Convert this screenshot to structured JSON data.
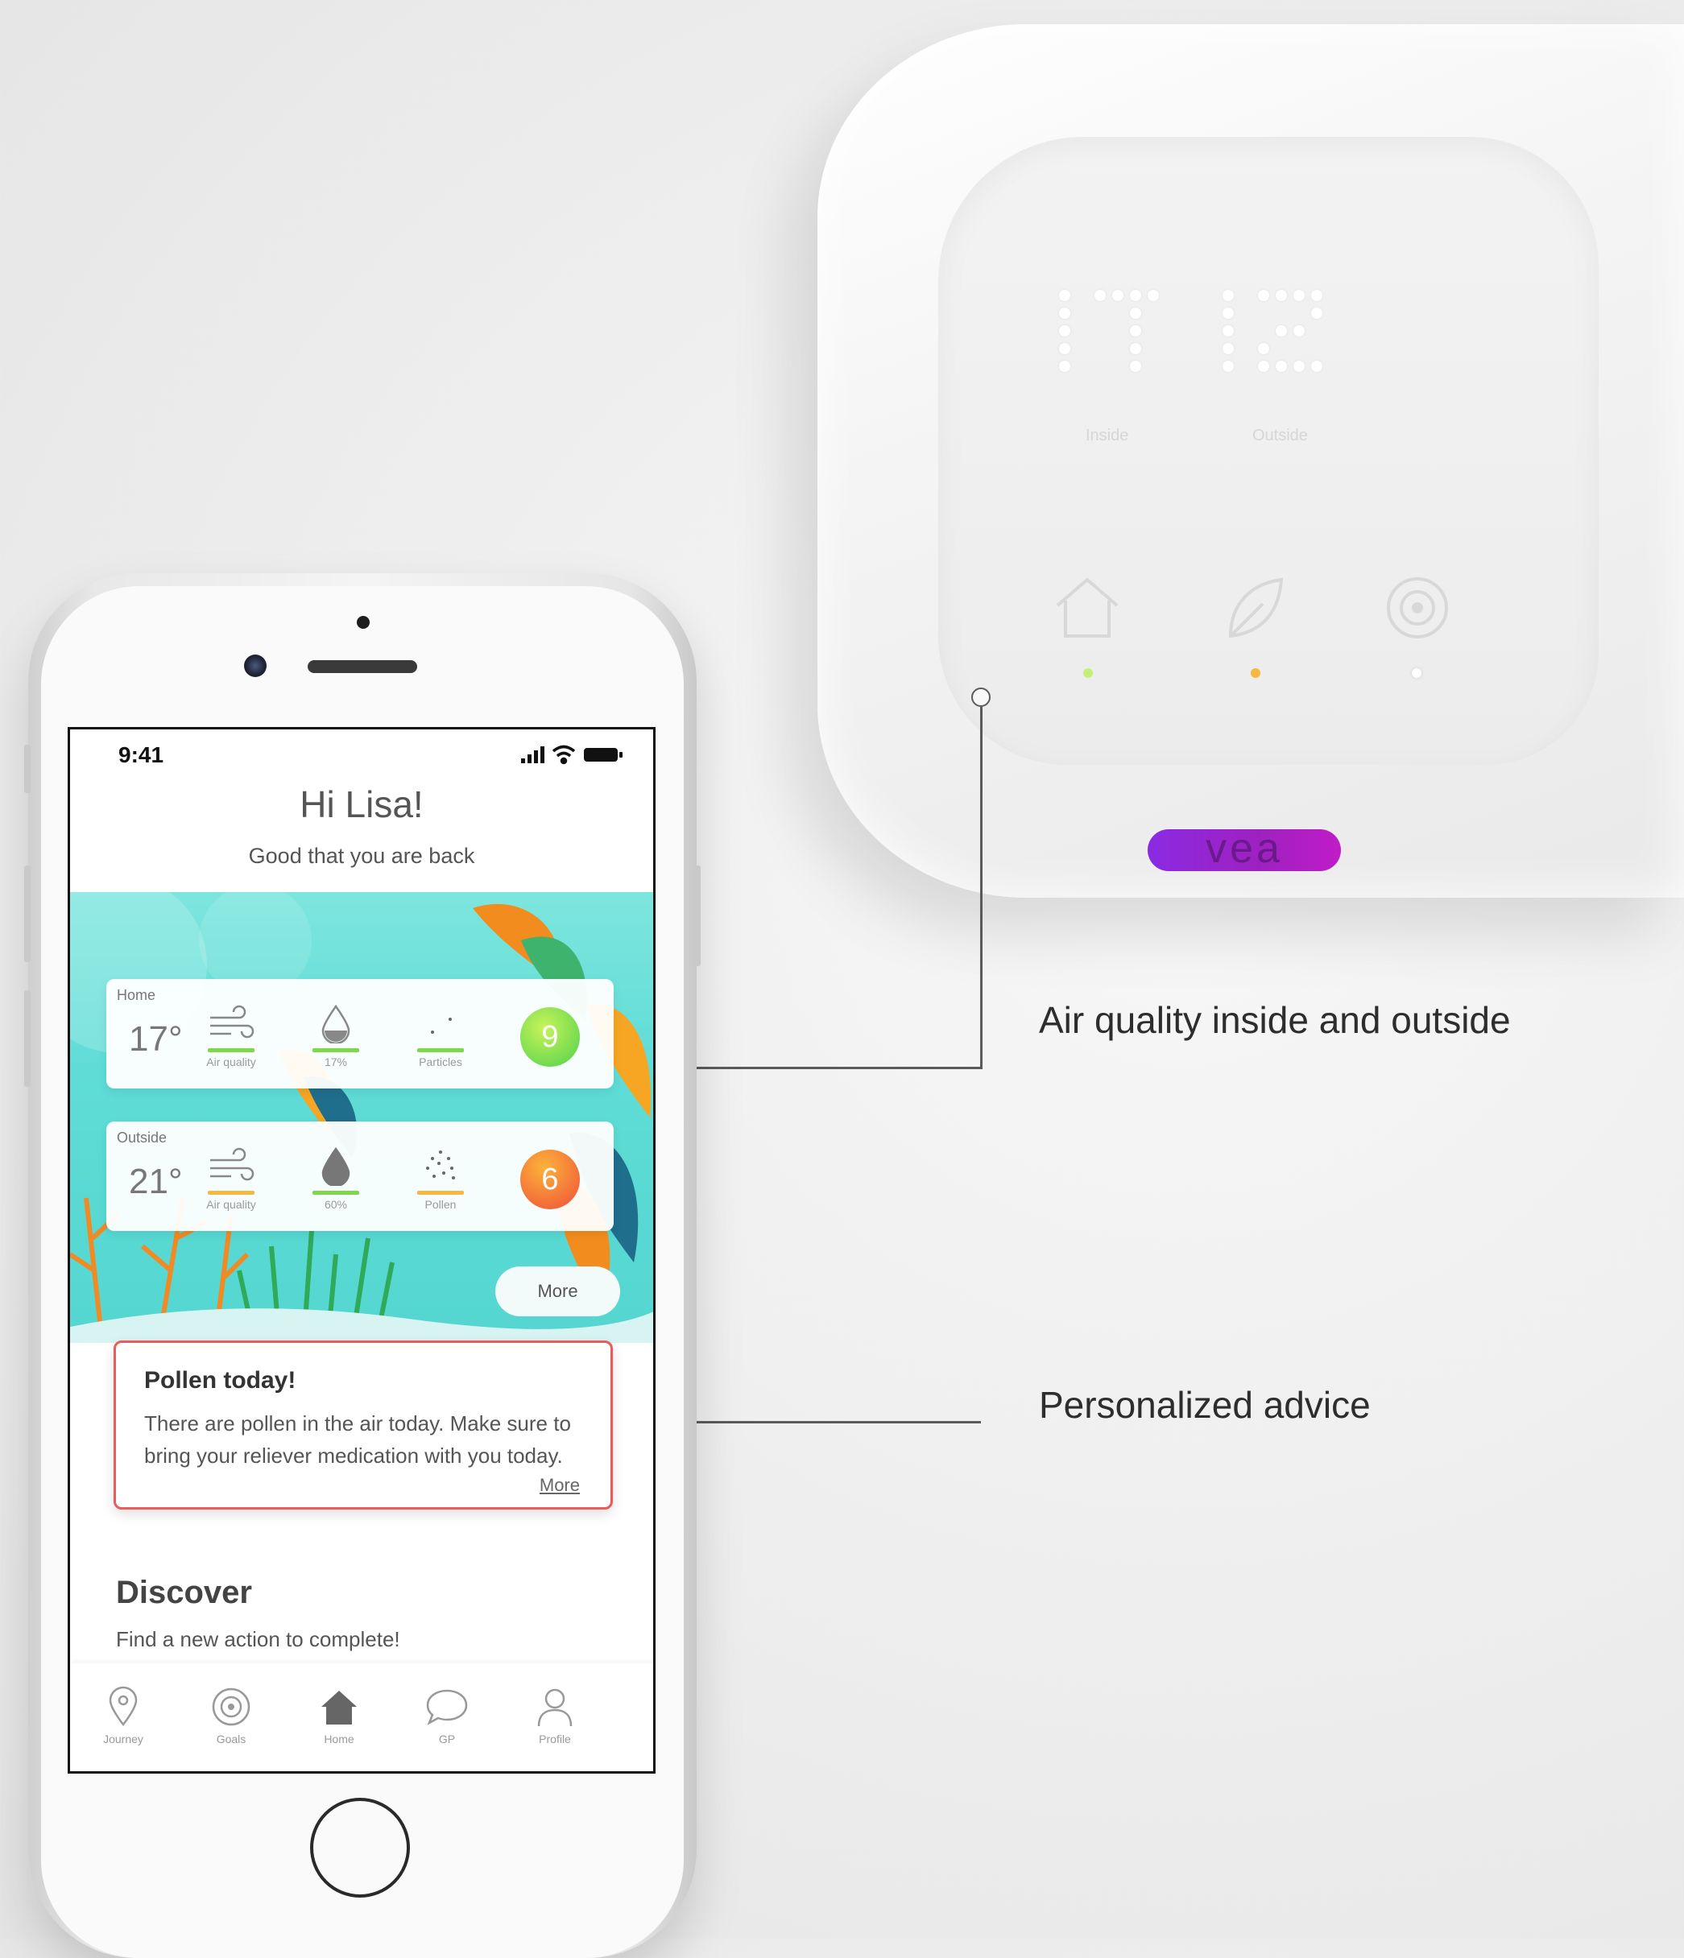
{
  "device": {
    "brand": "vea",
    "inside_reading": "17",
    "outside_reading": "12",
    "inside_label": "Inside",
    "outside_label": "Outside",
    "icons": [
      "home-icon",
      "leaf-icon",
      "target-icon"
    ],
    "led_colors": [
      "#b5e86a",
      "#f5b942",
      "#ffffff"
    ]
  },
  "callouts": {
    "air_quality": "Air quality inside and outside",
    "advice": "Personalized advice"
  },
  "app": {
    "status": {
      "time": "9:41"
    },
    "greeting": "Hi Lisa!",
    "sub_greeting": "Good that you are back",
    "cards": [
      {
        "location": "Home",
        "temperature": "17°",
        "metrics": [
          {
            "icon": "wind-icon",
            "label": "Air quality",
            "bar_color": "#7fd84a"
          },
          {
            "icon": "drop-icon",
            "label": "17%",
            "bar_color": "#7fd84a"
          },
          {
            "icon": "particles-icon",
            "label": "Particles",
            "bar_color": "#7fd84a"
          }
        ],
        "score": "9",
        "score_color_from": "#b8f04a",
        "score_color_to": "#54d24a"
      },
      {
        "location": "Outside",
        "temperature": "21°",
        "metrics": [
          {
            "icon": "wind-icon",
            "label": "Air quality",
            "bar_color": "#f5b942"
          },
          {
            "icon": "drop-icon",
            "label": "60%",
            "bar_color": "#7fd84a"
          },
          {
            "icon": "pollen-icon",
            "label": "Pollen",
            "bar_color": "#f5b942"
          }
        ],
        "score": "6",
        "score_color_from": "#f9b23a",
        "score_color_to": "#f05a3a"
      }
    ],
    "more_button": "More",
    "advice": {
      "title": "Pollen today!",
      "body": "There are pollen in the air today. Make sure to bring your reliever medication with you today.",
      "more_link": "More"
    },
    "discover": {
      "title": "Discover",
      "subtitle": "Find a new action to complete!"
    },
    "tabs": [
      {
        "label": "Journey",
        "icon": "location-pin-icon"
      },
      {
        "label": "Goals",
        "icon": "target-icon"
      },
      {
        "label": "Home",
        "icon": "home-icon",
        "active": true
      },
      {
        "label": "GP",
        "icon": "chat-bubble-icon"
      },
      {
        "label": "Profile",
        "icon": "person-icon"
      }
    ]
  }
}
